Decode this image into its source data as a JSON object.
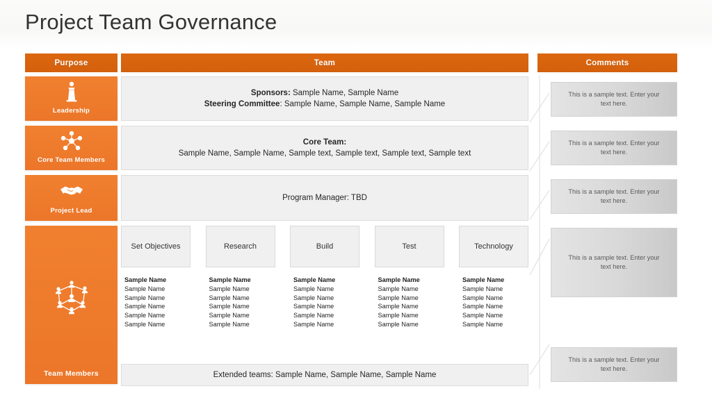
{
  "slide": {
    "title": "Project Team Governance"
  },
  "columns": {
    "purpose_header": "Purpose",
    "team_header": "Team",
    "comments_header": "Comments"
  },
  "rows": [
    {
      "purpose_label": "Leadership",
      "purpose_icon": "person-at-podium-icon",
      "team_lines": [
        {
          "bold": "Sponsors:",
          "text": " Sample Name, Sample Name"
        },
        {
          "bold": "Steering Committee",
          "text": ": Sample Name, Sample Name, Sample Name"
        }
      ]
    },
    {
      "purpose_label": "Core Team Members",
      "purpose_icon": "network-nodes-icon",
      "team_title": "Core Team:",
      "team_lines": [
        {
          "bold": "",
          "text": "Sample Name, Sample Name, Sample text, Sample text, Sample text, Sample text"
        }
      ]
    },
    {
      "purpose_label": "Project Lead",
      "purpose_icon": "handshake-icon",
      "team_lines": [
        {
          "bold": "",
          "text": "Program Manager: TBD"
        }
      ]
    },
    {
      "purpose_label": "Team Members",
      "purpose_icon": "people-network-icon"
    }
  ],
  "subteams": [
    {
      "title": "Set Objectives",
      "members": [
        "Sample Name",
        "Sample Name",
        "Sample Name",
        "Sample Name",
        "Sample Name",
        "Sample Name"
      ]
    },
    {
      "title": "Research",
      "members": [
        "Sample Name",
        "Sample Name",
        "Sample Name",
        "Sample Name",
        "Sample Name",
        "Sample Name"
      ]
    },
    {
      "title": "Build",
      "members": [
        "Sample Name",
        "Sample Name",
        "Sample Name",
        "Sample Name",
        "Sample Name",
        "Sample Name"
      ]
    },
    {
      "title": "Test",
      "members": [
        "Sample Name",
        "Sample Name",
        "Sample Name",
        "Sample Name",
        "Sample Name",
        "Sample Name"
      ]
    },
    {
      "title": "Technology",
      "members": [
        "Sample Name",
        "Sample Name",
        "Sample Name",
        "Sample Name",
        "Sample Name",
        "Sample Name"
      ]
    }
  ],
  "extended_teams": {
    "text": "Extended teams: Sample Name, Sample Name, Sample Name"
  },
  "comments": [
    {
      "text": "This is a sample text. Enter your text here."
    },
    {
      "text": "This is a sample text. Enter your text here."
    },
    {
      "text": "This is a sample text. Enter your text here."
    },
    {
      "text": "This is a sample text. Enter your text here."
    },
    {
      "text": "This is a sample text. Enter your text here."
    }
  ],
  "colors": {
    "header_orange": "#d9650f",
    "cell_orange": "#ef7c2e",
    "panel_grey": "#f0f0f0",
    "comment_grey": "#d8d8d8",
    "title_text": "#333333"
  }
}
